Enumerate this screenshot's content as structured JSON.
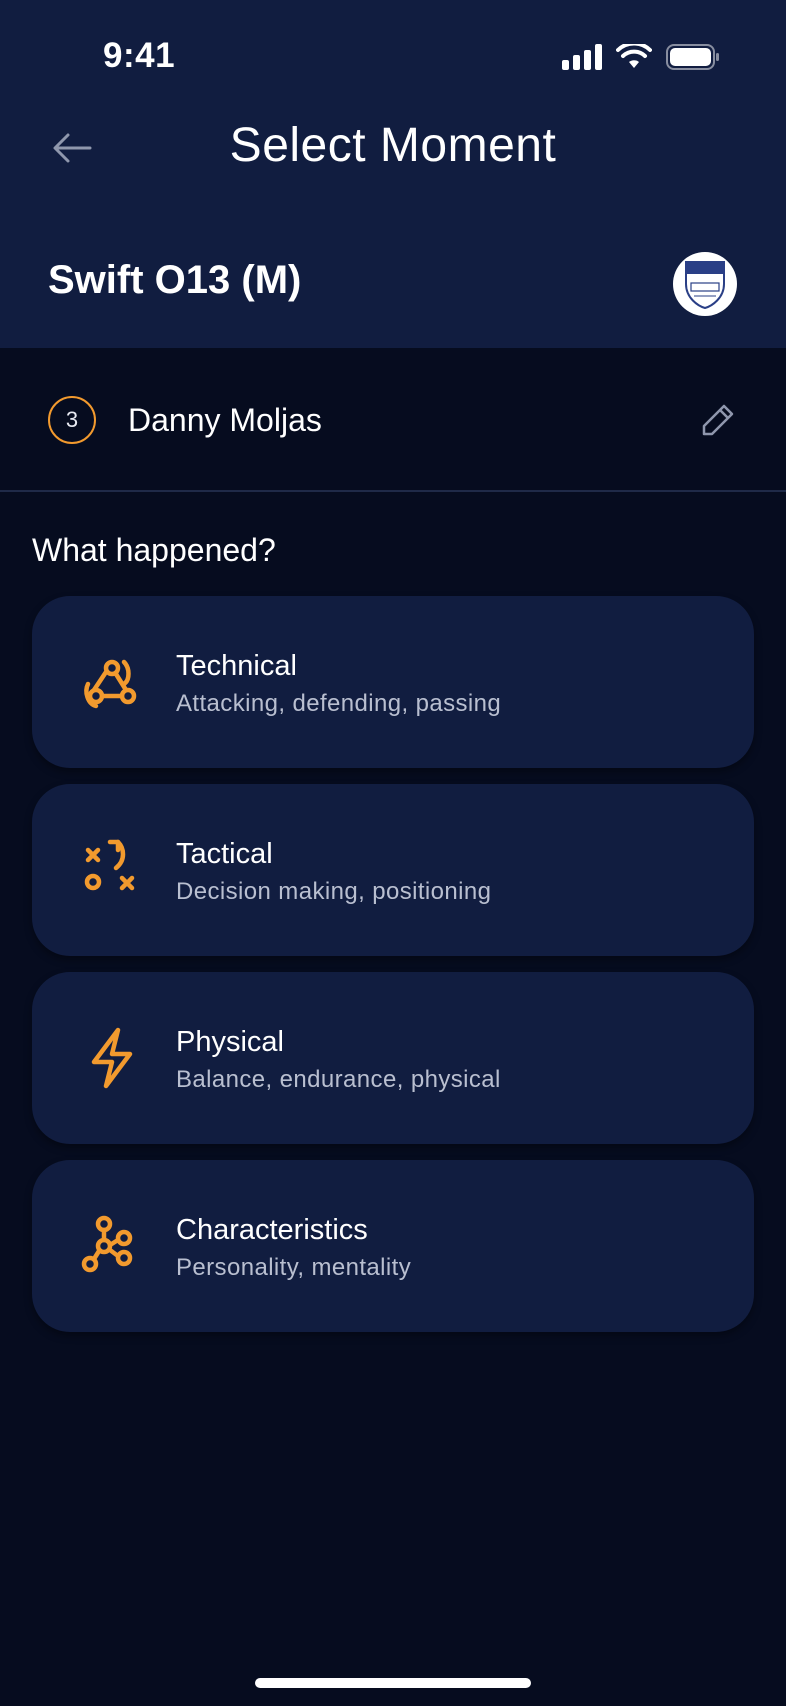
{
  "status_bar": {
    "time": "9:41"
  },
  "header": {
    "title": "Select Moment",
    "team_name": "Swift O13 (M)"
  },
  "player": {
    "number": "3",
    "name": "Danny Moljas"
  },
  "question": "What happened?",
  "categories": [
    {
      "title": "Technical",
      "subtitle": "Attacking, defending, passing",
      "icon": "webhook-icon"
    },
    {
      "title": "Tactical",
      "subtitle": "Decision making, positioning",
      "icon": "tactics-icon"
    },
    {
      "title": "Physical",
      "subtitle": "Balance, endurance, physical",
      "icon": "lightning-icon"
    },
    {
      "title": "Characteristics",
      "subtitle": "Personality, mentality",
      "icon": "network-icon"
    }
  ],
  "colors": {
    "header_bg": "#111d40",
    "page_bg": "#060c1f",
    "accent": "#f29a2e",
    "card_bg": "#111d40"
  }
}
